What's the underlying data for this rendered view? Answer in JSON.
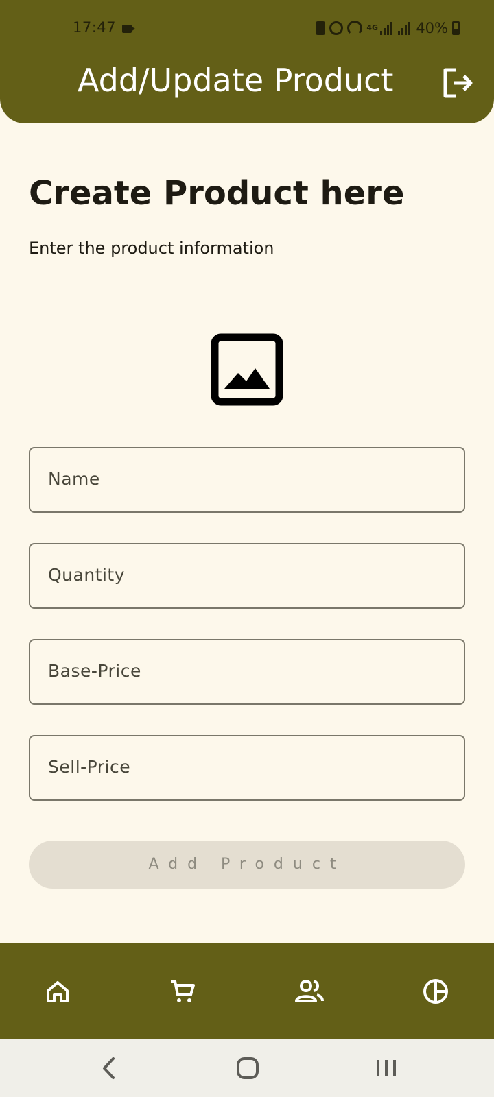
{
  "status_bar": {
    "time": "17:47",
    "battery_percent": "40%",
    "network_label": "4G",
    "icons": [
      "video-record-icon",
      "battery-saver-icon",
      "alarm-icon",
      "hotspot-icon",
      "signal-icon",
      "signal-icon",
      "battery-icon"
    ]
  },
  "app_bar": {
    "title": "Add/Update Product",
    "logout_icon": "logout-icon"
  },
  "form": {
    "heading": "Create Product here",
    "subheading": "Enter the product information",
    "image_icon": "image-icon",
    "fields": {
      "name": {
        "placeholder": "Name",
        "value": ""
      },
      "quantity": {
        "placeholder": "Quantity",
        "value": ""
      },
      "base_price": {
        "placeholder": "Base-Price",
        "value": ""
      },
      "sell_price": {
        "placeholder": "Sell-Price",
        "value": ""
      }
    },
    "submit_label": "Add Product"
  },
  "bottom_nav": {
    "items": [
      {
        "icon": "home-icon"
      },
      {
        "icon": "cart-icon"
      },
      {
        "icon": "customers-icon"
      },
      {
        "icon": "pie-chart-icon"
      }
    ]
  },
  "system_nav": {
    "buttons": [
      "back-icon",
      "home-circle-icon",
      "recents-icon"
    ]
  },
  "colors": {
    "primary": "#635f17",
    "background": "#fdf8eb",
    "button_disabled_bg": "#e4ded1",
    "button_disabled_text": "#8e8b80",
    "field_border": "#7a776a"
  }
}
